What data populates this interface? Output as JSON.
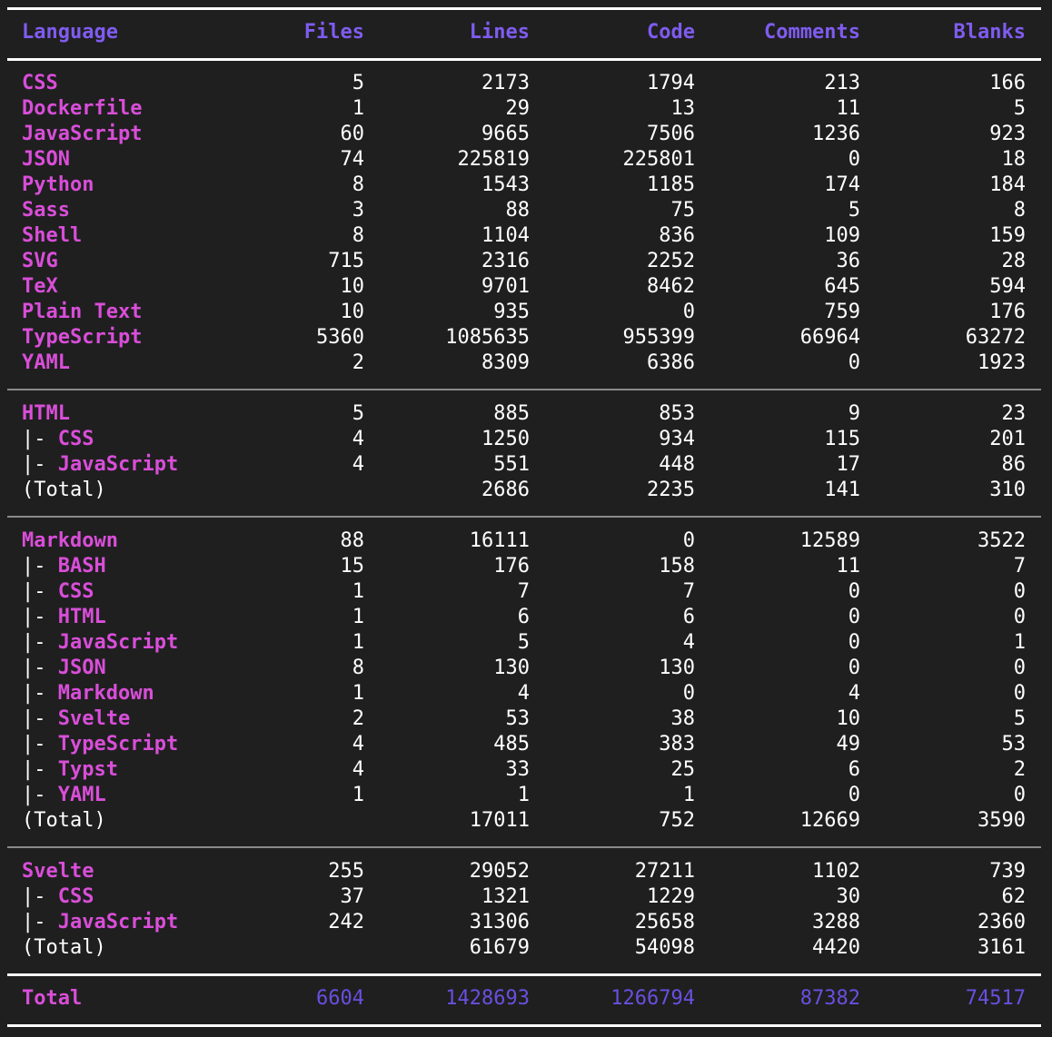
{
  "colors": {
    "background": "#1f1f1f",
    "header": "#7f5cf0",
    "language": "#d94ed9",
    "total_numbers": "#6a4fe0"
  },
  "header": {
    "language": "Language",
    "files": "Files",
    "lines": "Lines",
    "code": "Code",
    "comments": "Comments",
    "blanks": "Blanks"
  },
  "group1": [
    {
      "lang": "CSS",
      "files": "5",
      "lines": "2173",
      "code": "1794",
      "comments": "213",
      "blanks": "166"
    },
    {
      "lang": "Dockerfile",
      "files": "1",
      "lines": "29",
      "code": "13",
      "comments": "11",
      "blanks": "5"
    },
    {
      "lang": "JavaScript",
      "files": "60",
      "lines": "9665",
      "code": "7506",
      "comments": "1236",
      "blanks": "923"
    },
    {
      "lang": "JSON",
      "files": "74",
      "lines": "225819",
      "code": "225801",
      "comments": "0",
      "blanks": "18"
    },
    {
      "lang": "Python",
      "files": "8",
      "lines": "1543",
      "code": "1185",
      "comments": "174",
      "blanks": "184"
    },
    {
      "lang": "Sass",
      "files": "3",
      "lines": "88",
      "code": "75",
      "comments": "5",
      "blanks": "8"
    },
    {
      "lang": "Shell",
      "files": "8",
      "lines": "1104",
      "code": "836",
      "comments": "109",
      "blanks": "159"
    },
    {
      "lang": "SVG",
      "files": "715",
      "lines": "2316",
      "code": "2252",
      "comments": "36",
      "blanks": "28"
    },
    {
      "lang": "TeX",
      "files": "10",
      "lines": "9701",
      "code": "8462",
      "comments": "645",
      "blanks": "594"
    },
    {
      "lang": "Plain Text",
      "files": "10",
      "lines": "935",
      "code": "0",
      "comments": "759",
      "blanks": "176"
    },
    {
      "lang": "TypeScript",
      "files": "5360",
      "lines": "1085635",
      "code": "955399",
      "comments": "66964",
      "blanks": "63272"
    },
    {
      "lang": "YAML",
      "files": "2",
      "lines": "8309",
      "code": "6386",
      "comments": "0",
      "blanks": "1923"
    }
  ],
  "group2": [
    {
      "prefix": "",
      "lang": "HTML",
      "files": "5",
      "lines": "885",
      "code": "853",
      "comments": "9",
      "blanks": "23"
    },
    {
      "prefix": "|- ",
      "lang": "CSS",
      "files": "4",
      "lines": "1250",
      "code": "934",
      "comments": "115",
      "blanks": "201"
    },
    {
      "prefix": "|- ",
      "lang": "JavaScript",
      "files": "4",
      "lines": "551",
      "code": "448",
      "comments": "17",
      "blanks": "86"
    },
    {
      "prefix": "(Total)",
      "lang": "",
      "files": "",
      "lines": "2686",
      "code": "2235",
      "comments": "141",
      "blanks": "310"
    }
  ],
  "group3": [
    {
      "prefix": "",
      "lang": "Markdown",
      "files": "88",
      "lines": "16111",
      "code": "0",
      "comments": "12589",
      "blanks": "3522"
    },
    {
      "prefix": "|- ",
      "lang": "BASH",
      "files": "15",
      "lines": "176",
      "code": "158",
      "comments": "11",
      "blanks": "7"
    },
    {
      "prefix": "|- ",
      "lang": "CSS",
      "files": "1",
      "lines": "7",
      "code": "7",
      "comments": "0",
      "blanks": "0"
    },
    {
      "prefix": "|- ",
      "lang": "HTML",
      "files": "1",
      "lines": "6",
      "code": "6",
      "comments": "0",
      "blanks": "0"
    },
    {
      "prefix": "|- ",
      "lang": "JavaScript",
      "files": "1",
      "lines": "5",
      "code": "4",
      "comments": "0",
      "blanks": "1"
    },
    {
      "prefix": "|- ",
      "lang": "JSON",
      "files": "8",
      "lines": "130",
      "code": "130",
      "comments": "0",
      "blanks": "0"
    },
    {
      "prefix": "|- ",
      "lang": "Markdown",
      "files": "1",
      "lines": "4",
      "code": "0",
      "comments": "4",
      "blanks": "0"
    },
    {
      "prefix": "|- ",
      "lang": "Svelte",
      "files": "2",
      "lines": "53",
      "code": "38",
      "comments": "10",
      "blanks": "5"
    },
    {
      "prefix": "|- ",
      "lang": "TypeScript",
      "files": "4",
      "lines": "485",
      "code": "383",
      "comments": "49",
      "blanks": "53"
    },
    {
      "prefix": "|- ",
      "lang": "Typst",
      "files": "4",
      "lines": "33",
      "code": "25",
      "comments": "6",
      "blanks": "2"
    },
    {
      "prefix": "|- ",
      "lang": "YAML",
      "files": "1",
      "lines": "1",
      "code": "1",
      "comments": "0",
      "blanks": "0"
    },
    {
      "prefix": "(Total)",
      "lang": "",
      "files": "",
      "lines": "17011",
      "code": "752",
      "comments": "12669",
      "blanks": "3590"
    }
  ],
  "group4": [
    {
      "prefix": "",
      "lang": "Svelte",
      "files": "255",
      "lines": "29052",
      "code": "27211",
      "comments": "1102",
      "blanks": "739"
    },
    {
      "prefix": "|- ",
      "lang": "CSS",
      "files": "37",
      "lines": "1321",
      "code": "1229",
      "comments": "30",
      "blanks": "62"
    },
    {
      "prefix": "|- ",
      "lang": "JavaScript",
      "files": "242",
      "lines": "31306",
      "code": "25658",
      "comments": "3288",
      "blanks": "2360"
    },
    {
      "prefix": "(Total)",
      "lang": "",
      "files": "",
      "lines": "61679",
      "code": "54098",
      "comments": "4420",
      "blanks": "3161"
    }
  ],
  "total": {
    "label": "Total",
    "files": "6604",
    "lines": "1428693",
    "code": "1266794",
    "comments": "87382",
    "blanks": "74517"
  }
}
